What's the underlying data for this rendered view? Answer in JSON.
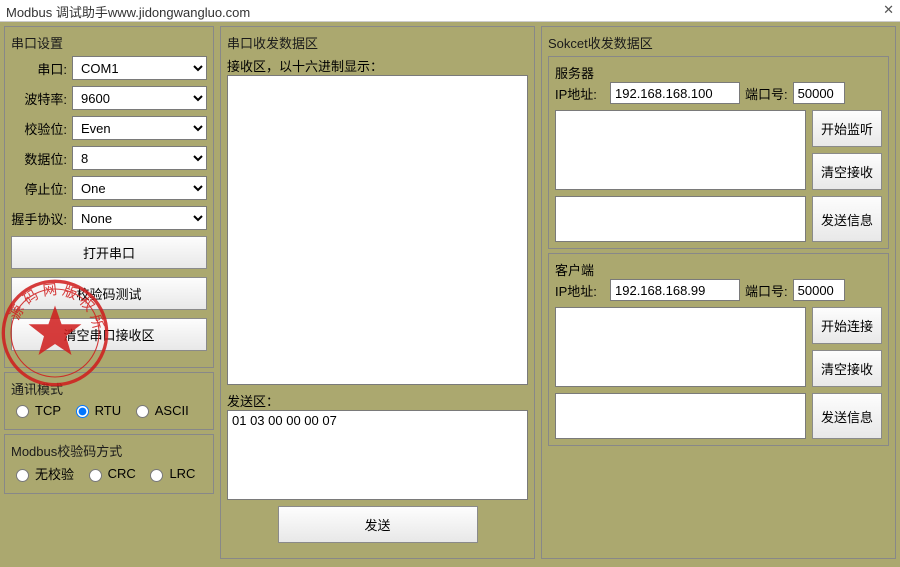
{
  "window": {
    "title": "Modbus 调试助手www.jidongwangluo.com",
    "close": "✕"
  },
  "serial": {
    "group_title": "串口设置",
    "port_label": "串口:",
    "port_value": "COM1",
    "baud_label": "波特率:",
    "baud_value": "9600",
    "parity_label": "校验位:",
    "parity_value": "Even",
    "databits_label": "数据位:",
    "databits_value": "8",
    "stopbits_label": "停止位:",
    "stopbits_value": "One",
    "handshake_label": "握手协议:",
    "handshake_value": "None",
    "open_btn": "打开串口",
    "crc_btn": "校验码测试",
    "clear_btn": "清空串口接收区"
  },
  "mode": {
    "group_title": "通讯模式",
    "tcp": "TCP",
    "rtu": "RTU",
    "ascii": "ASCII"
  },
  "crcmode": {
    "group_title": "Modbus校验码方式",
    "none": "无校验",
    "crc": "CRC",
    "lrc": "LRC"
  },
  "serialio": {
    "group_title": "串口收发数据区",
    "recv_label": "接收区，以十六进制显示：",
    "recv_value": "",
    "send_label": "发送区：",
    "send_value": "01 03 00 00 00 07",
    "send_btn": "发送"
  },
  "socket": {
    "group_title": "Sokcet收发数据区",
    "server": {
      "title": "服务器",
      "ip_label": "IP地址:",
      "ip_value": "192.168.168.100",
      "port_label": "端口号:",
      "port_value": "50000",
      "listen_btn": "开始监听",
      "clear_btn": "清空接收",
      "send_btn": "发送信息"
    },
    "client": {
      "title": "客户端",
      "ip_label": "IP地址:",
      "ip_value": "192.168.168.99",
      "port_label": "端口号:",
      "port_value": "50000",
      "connect_btn": "开始连接",
      "clear_btn": "清空接收",
      "send_btn": "发送信息"
    }
  }
}
